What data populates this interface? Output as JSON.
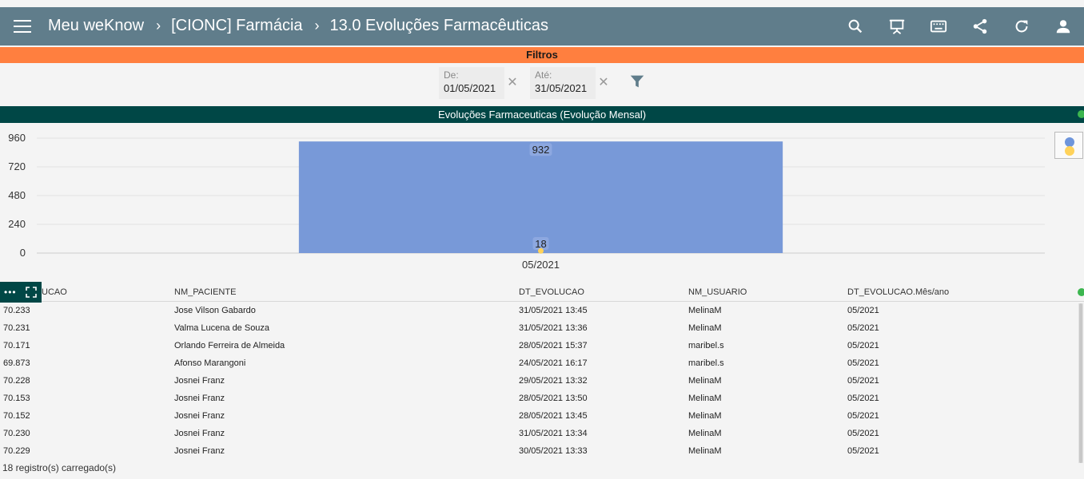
{
  "header": {
    "breadcrumbs": [
      "Meu weKnow",
      "[CIONC] Farmácia",
      "13.0 Evoluções Farmacêuticas"
    ],
    "icons": [
      "search-icon",
      "presentation-icon",
      "keyboard-icon",
      "share-icon",
      "refresh-icon",
      "user-icon"
    ]
  },
  "filters": {
    "title": "Filtros",
    "from": {
      "label": "De:",
      "value": "01/05/2021"
    },
    "to": {
      "label": "Até:",
      "value": "31/05/2021"
    },
    "clear_glyph": "✕"
  },
  "chart": {
    "title": "Evoluções Farmaceuticas (Evolução Mensal)"
  },
  "chart_data": {
    "type": "bar",
    "title": "Evoluções Farmaceuticas (Evolução Mensal)",
    "categories": [
      "05/2021"
    ],
    "series": [
      {
        "values": [
          932
        ],
        "color": "#7899d8"
      },
      {
        "values": [
          18
        ],
        "color": "#ffd25a"
      }
    ],
    "yticks": [
      "960",
      "720",
      "480",
      "240",
      "0"
    ],
    "ylim": [
      0,
      960
    ],
    "grid": true,
    "legend": "right"
  },
  "table": {
    "columns": [
      "UCAO",
      "NM_PACIENTE",
      "DT_EVOLUCAO",
      "NM_USUARIO",
      "DT_EVOLUCAO.Mês/ano"
    ],
    "rows": [
      [
        "70.233",
        "Jose Vilson Gabardo",
        "31/05/2021 13:45",
        "MelinaM",
        "05/2021"
      ],
      [
        "70.231",
        "Valma Lucena de Souza",
        "31/05/2021 13:36",
        "MelinaM",
        "05/2021"
      ],
      [
        "70.171",
        "Orlando Ferreira de Almeida",
        "28/05/2021 15:37",
        "maribel.s",
        "05/2021"
      ],
      [
        "69.873",
        "Afonso Marangoni",
        "24/05/2021 16:17",
        "maribel.s",
        "05/2021"
      ],
      [
        "70.228",
        "Josnei Franz",
        "29/05/2021 13:32",
        "MelinaM",
        "05/2021"
      ],
      [
        "70.153",
        "Josnei Franz",
        "28/05/2021 13:50",
        "MelinaM",
        "05/2021"
      ],
      [
        "70.152",
        "Josnei Franz",
        "28/05/2021 13:45",
        "MelinaM",
        "05/2021"
      ],
      [
        "70.230",
        "Josnei Franz",
        "31/05/2021 13:34",
        "MelinaM",
        "05/2021"
      ],
      [
        "70.229",
        "Josnei Franz",
        "30/05/2021 13:33",
        "MelinaM",
        "05/2021"
      ]
    ],
    "footer": "18 registro(s) carregado(s)"
  },
  "colors": {
    "header_bg": "#607d8b",
    "filters_bar": "#ff7f3f",
    "chart_title_bg": "#004746",
    "status": "#3cb64f"
  }
}
